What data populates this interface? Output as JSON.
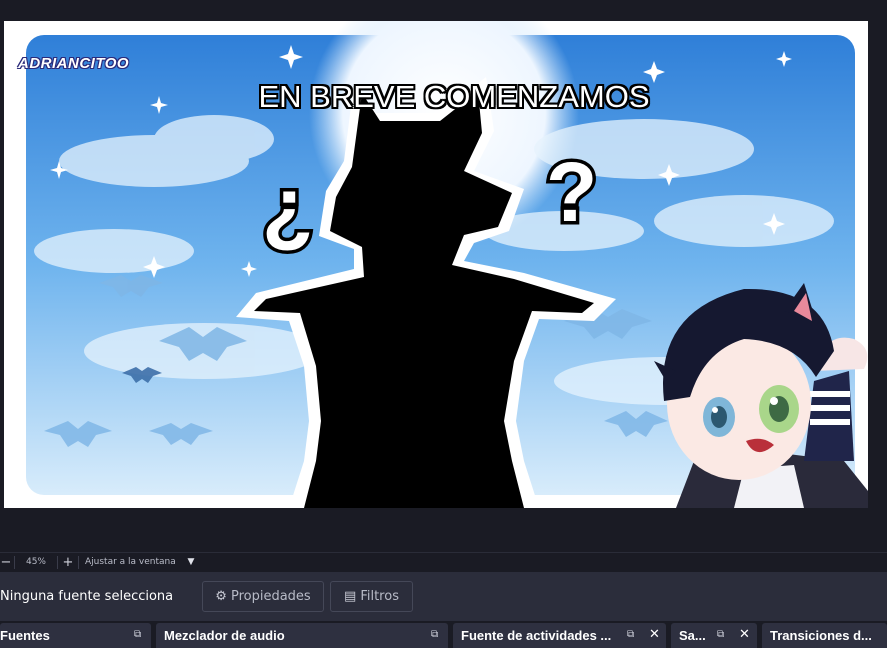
{
  "preview": {
    "headline": "EN BREVE COMENZAMOS",
    "logo_text": "ADRIANCITOO",
    "left_glyph": "¿",
    "right_glyph": "?"
  },
  "zoom_bar": {
    "zoom_out": "−",
    "zoom_value": "45%",
    "zoom_in": "+",
    "fit_label": "Ajustar a la ventana",
    "dropdown": "▼"
  },
  "source_bar": {
    "no_source_text": "Ninguna fuente selecciona",
    "properties_label": "Propiedades",
    "filters_label": "Filtros"
  },
  "docks": [
    {
      "title": "Fuentes"
    },
    {
      "title": "Mezclador de audio"
    },
    {
      "title": "Fuente de actividades ..."
    },
    {
      "title": "Sa..."
    },
    {
      "title": "Transiciones d..."
    }
  ],
  "icons": {
    "gear": "gear-icon",
    "filter": "filter-icon",
    "float": "float-icon",
    "close": "close-icon"
  },
  "colors": {
    "background": "#1e1f29",
    "panel": "#2b2d3b",
    "dock": "#2e3040",
    "sky": "#4fa0e8"
  }
}
